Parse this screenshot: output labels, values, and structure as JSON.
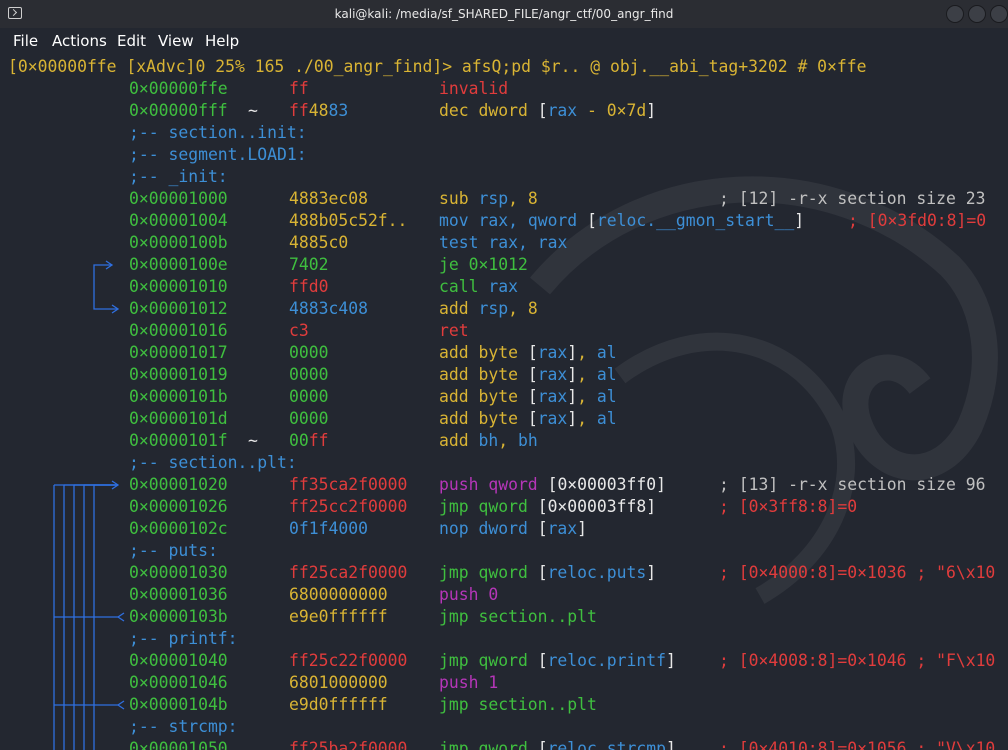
{
  "window": {
    "title": "kali@kali: /media/sf_SHARED_FILE/angr_ctf/00_angr_find",
    "icons": [
      "terminal-icon",
      "minimize-icon",
      "maximize-icon",
      "close-icon"
    ]
  },
  "menu": [
    "File",
    "Actions",
    "Edit",
    "View",
    "Help"
  ],
  "prompt": "[0×00000ffe [xAdvc]0 25% 165 ./00_angr_find]> afsQ;pd $r.. @ obj.__abi_tag+3202 # 0×ffe",
  "colors": {
    "background": "#232730",
    "address": "#3fbf3f",
    "prompt": "#d9b434",
    "mnemonic": "#d9b434",
    "register": "#3d8fd6",
    "error": "#e03c3c",
    "push": "#b536b8",
    "arrows": "#2f6fe0"
  },
  "lines": [
    {
      "addr": "0×00000ffe",
      "mark": "",
      "bytes": [
        {
          "t": "ff",
          "c": "red"
        }
      ],
      "ins": [
        {
          "t": "invalid",
          "c": "red"
        }
      ],
      "cmt": ""
    },
    {
      "addr": "0×00000fff",
      "mark": "~",
      "bytes": [
        {
          "t": "ff",
          "c": "red"
        },
        {
          "t": "48",
          "c": "yellow"
        },
        {
          "t": "83",
          "c": "blue"
        }
      ],
      "ins": [
        {
          "t": "dec dword ",
          "c": "yellow"
        },
        {
          "t": "[",
          "c": "white"
        },
        {
          "t": "rax",
          "c": "blue"
        },
        {
          "t": " - ",
          "c": "yellow"
        },
        {
          "t": "0×7d",
          "c": "yellow"
        },
        {
          "t": "]",
          "c": "white"
        }
      ],
      "cmt": ""
    },
    {
      "label": ";-- section..init:"
    },
    {
      "label": ";-- segment.LOAD1:"
    },
    {
      "label": ";-- _init:"
    },
    {
      "addr": "0×00001000",
      "mark": "",
      "bytes": [
        {
          "t": "4883ec08",
          "c": "yellow"
        }
      ],
      "ins": [
        {
          "t": "sub ",
          "c": "yellow"
        },
        {
          "t": "rsp",
          "c": "blue"
        },
        {
          "t": ", 8",
          "c": "yellow"
        }
      ],
      "cmt": "; [12] -r-x section size 23",
      "cc": "grey"
    },
    {
      "addr": "0×00001004",
      "mark": "",
      "bytes": [
        {
          "t": "488b05c52f..",
          "c": "yellow"
        }
      ],
      "ins": [
        {
          "t": "mov ",
          "c": "blue"
        },
        {
          "t": "rax",
          "c": "blue"
        },
        {
          "t": ", qword ",
          "c": "blue"
        },
        {
          "t": "[",
          "c": "white"
        },
        {
          "t": "reloc.__gmon_start__",
          "c": "blue"
        },
        {
          "t": "]",
          "c": "white"
        }
      ],
      "cmt": "; [0×3fd0:8]=0",
      "cc": "red",
      "cmtx": 848
    },
    {
      "addr": "0×0000100b",
      "mark": "",
      "bytes": [
        {
          "t": "4885c0",
          "c": "yellow"
        }
      ],
      "ins": [
        {
          "t": "test ",
          "c": "blue"
        },
        {
          "t": "rax",
          "c": "blue"
        },
        {
          "t": ", ",
          "c": "blue"
        },
        {
          "t": "rax",
          "c": "blue"
        }
      ],
      "cmt": ""
    },
    {
      "addr": "0×0000100e",
      "mark": "",
      "bytes": [
        {
          "t": "7402",
          "c": "green"
        }
      ],
      "ins": [
        {
          "t": "je 0×1012",
          "c": "green"
        }
      ],
      "cmt": ""
    },
    {
      "addr": "0×00001010",
      "mark": "",
      "bytes": [
        {
          "t": "ffd0",
          "c": "red"
        }
      ],
      "ins": [
        {
          "t": "call ",
          "c": "green"
        },
        {
          "t": "rax",
          "c": "blue"
        }
      ],
      "cmt": ""
    },
    {
      "addr": "0×00001012",
      "mark": "",
      "bytes": [
        {
          "t": "4883c408",
          "c": "blue"
        }
      ],
      "ins": [
        {
          "t": "add ",
          "c": "yellow"
        },
        {
          "t": "rsp",
          "c": "blue"
        },
        {
          "t": ", 8",
          "c": "yellow"
        }
      ],
      "cmt": ""
    },
    {
      "addr": "0×00001016",
      "mark": "",
      "bytes": [
        {
          "t": "c3",
          "c": "red"
        }
      ],
      "ins": [
        {
          "t": "ret",
          "c": "red"
        }
      ],
      "cmt": ""
    },
    {
      "addr": "0×00001017",
      "mark": "",
      "bytes": [
        {
          "t": "0000",
          "c": "green"
        }
      ],
      "ins": [
        {
          "t": "add byte ",
          "c": "yellow"
        },
        {
          "t": "[",
          "c": "white"
        },
        {
          "t": "rax",
          "c": "blue"
        },
        {
          "t": "]",
          "c": "white"
        },
        {
          "t": ", ",
          "c": "yellow"
        },
        {
          "t": "al",
          "c": "blue"
        }
      ],
      "cmt": ""
    },
    {
      "addr": "0×00001019",
      "mark": "",
      "bytes": [
        {
          "t": "0000",
          "c": "green"
        }
      ],
      "ins": [
        {
          "t": "add byte ",
          "c": "yellow"
        },
        {
          "t": "[",
          "c": "white"
        },
        {
          "t": "rax",
          "c": "blue"
        },
        {
          "t": "]",
          "c": "white"
        },
        {
          "t": ", ",
          "c": "yellow"
        },
        {
          "t": "al",
          "c": "blue"
        }
      ],
      "cmt": ""
    },
    {
      "addr": "0×0000101b",
      "mark": "",
      "bytes": [
        {
          "t": "0000",
          "c": "green"
        }
      ],
      "ins": [
        {
          "t": "add byte ",
          "c": "yellow"
        },
        {
          "t": "[",
          "c": "white"
        },
        {
          "t": "rax",
          "c": "blue"
        },
        {
          "t": "]",
          "c": "white"
        },
        {
          "t": ", ",
          "c": "yellow"
        },
        {
          "t": "al",
          "c": "blue"
        }
      ],
      "cmt": ""
    },
    {
      "addr": "0×0000101d",
      "mark": "",
      "bytes": [
        {
          "t": "0000",
          "c": "green"
        }
      ],
      "ins": [
        {
          "t": "add byte ",
          "c": "yellow"
        },
        {
          "t": "[",
          "c": "white"
        },
        {
          "t": "rax",
          "c": "blue"
        },
        {
          "t": "]",
          "c": "white"
        },
        {
          "t": ", ",
          "c": "yellow"
        },
        {
          "t": "al",
          "c": "blue"
        }
      ],
      "cmt": ""
    },
    {
      "addr": "0×0000101f",
      "mark": "~",
      "bytes": [
        {
          "t": "00",
          "c": "green"
        },
        {
          "t": "ff",
          "c": "red"
        }
      ],
      "ins": [
        {
          "t": "add ",
          "c": "yellow"
        },
        {
          "t": "bh",
          "c": "blue"
        },
        {
          "t": ", ",
          "c": "yellow"
        },
        {
          "t": "bh",
          "c": "blue"
        }
      ],
      "cmt": ""
    },
    {
      "label": ";-- section..plt:"
    },
    {
      "addr": "0×00001020",
      "mark": "",
      "bytes": [
        {
          "t": "ff35ca2f0000",
          "c": "red"
        }
      ],
      "ins": [
        {
          "t": "push qword ",
          "c": "magenta"
        },
        {
          "t": "[",
          "c": "white"
        },
        {
          "t": "0×00003ff0",
          "c": "white"
        },
        {
          "t": "]",
          "c": "white"
        }
      ],
      "cmt": "; [13] -r-x section size 96",
      "cc": "grey"
    },
    {
      "addr": "0×00001026",
      "mark": "",
      "bytes": [
        {
          "t": "ff25cc2f0000",
          "c": "red"
        }
      ],
      "ins": [
        {
          "t": "jmp qword ",
          "c": "green"
        },
        {
          "t": "[",
          "c": "white"
        },
        {
          "t": "0×00003ff8",
          "c": "white"
        },
        {
          "t": "]",
          "c": "white"
        }
      ],
      "cmt": "; [0×3ff8:8]=0",
      "cc": "red"
    },
    {
      "addr": "0×0000102c",
      "mark": "",
      "bytes": [
        {
          "t": "0f1f4000",
          "c": "blue"
        }
      ],
      "ins": [
        {
          "t": "nop dword ",
          "c": "blue"
        },
        {
          "t": "[",
          "c": "white"
        },
        {
          "t": "rax",
          "c": "blue"
        },
        {
          "t": "]",
          "c": "white"
        }
      ],
      "cmt": ""
    },
    {
      "label": ";-- puts:"
    },
    {
      "addr": "0×00001030",
      "mark": "",
      "bytes": [
        {
          "t": "ff25ca2f0000",
          "c": "red"
        }
      ],
      "ins": [
        {
          "t": "jmp qword ",
          "c": "green"
        },
        {
          "t": "[",
          "c": "white"
        },
        {
          "t": "reloc.puts",
          "c": "blue"
        },
        {
          "t": "]",
          "c": "white"
        }
      ],
      "cmt": "; [0×4000:8]=0×1036 ; \"6\\x10",
      "cc": "red"
    },
    {
      "addr": "0×00001036",
      "mark": "",
      "bytes": [
        {
          "t": "6800000000",
          "c": "yellow"
        }
      ],
      "ins": [
        {
          "t": "push 0",
          "c": "magenta"
        }
      ],
      "cmt": ""
    },
    {
      "addr": "0×0000103b",
      "mark": "",
      "bytes": [
        {
          "t": "e9e0ffffff",
          "c": "yellow"
        }
      ],
      "ins": [
        {
          "t": "jmp section..plt",
          "c": "green"
        }
      ],
      "cmt": ""
    },
    {
      "label": ";-- printf:"
    },
    {
      "addr": "0×00001040",
      "mark": "",
      "bytes": [
        {
          "t": "ff25c22f0000",
          "c": "red"
        }
      ],
      "ins": [
        {
          "t": "jmp qword ",
          "c": "green"
        },
        {
          "t": "[",
          "c": "white"
        },
        {
          "t": "reloc.printf",
          "c": "blue"
        },
        {
          "t": "]",
          "c": "white"
        }
      ],
      "cmt": "; [0×4008:8]=0×1046 ; \"F\\x10",
      "cc": "red"
    },
    {
      "addr": "0×00001046",
      "mark": "",
      "bytes": [
        {
          "t": "6801000000",
          "c": "yellow"
        }
      ],
      "ins": [
        {
          "t": "push 1",
          "c": "magenta"
        }
      ],
      "cmt": ""
    },
    {
      "addr": "0×0000104b",
      "mark": "",
      "bytes": [
        {
          "t": "e9d0ffffff",
          "c": "yellow"
        }
      ],
      "ins": [
        {
          "t": "jmp section..plt",
          "c": "green"
        }
      ],
      "cmt": ""
    },
    {
      "label": ";-- strcmp:"
    },
    {
      "addr": "0×00001050",
      "mark": "",
      "bytes": [
        {
          "t": "ff25ba2f0000",
          "c": "red"
        }
      ],
      "ins": [
        {
          "t": "jmp qword ",
          "c": "green"
        },
        {
          "t": "[",
          "c": "white"
        },
        {
          "t": "reloc.strcmp",
          "c": "blue"
        },
        {
          "t": "]",
          "c": "white"
        }
      ],
      "cmt": "; [0×4010:8]=0×1056 ; \"V\\x10",
      "cc": "red"
    }
  ]
}
